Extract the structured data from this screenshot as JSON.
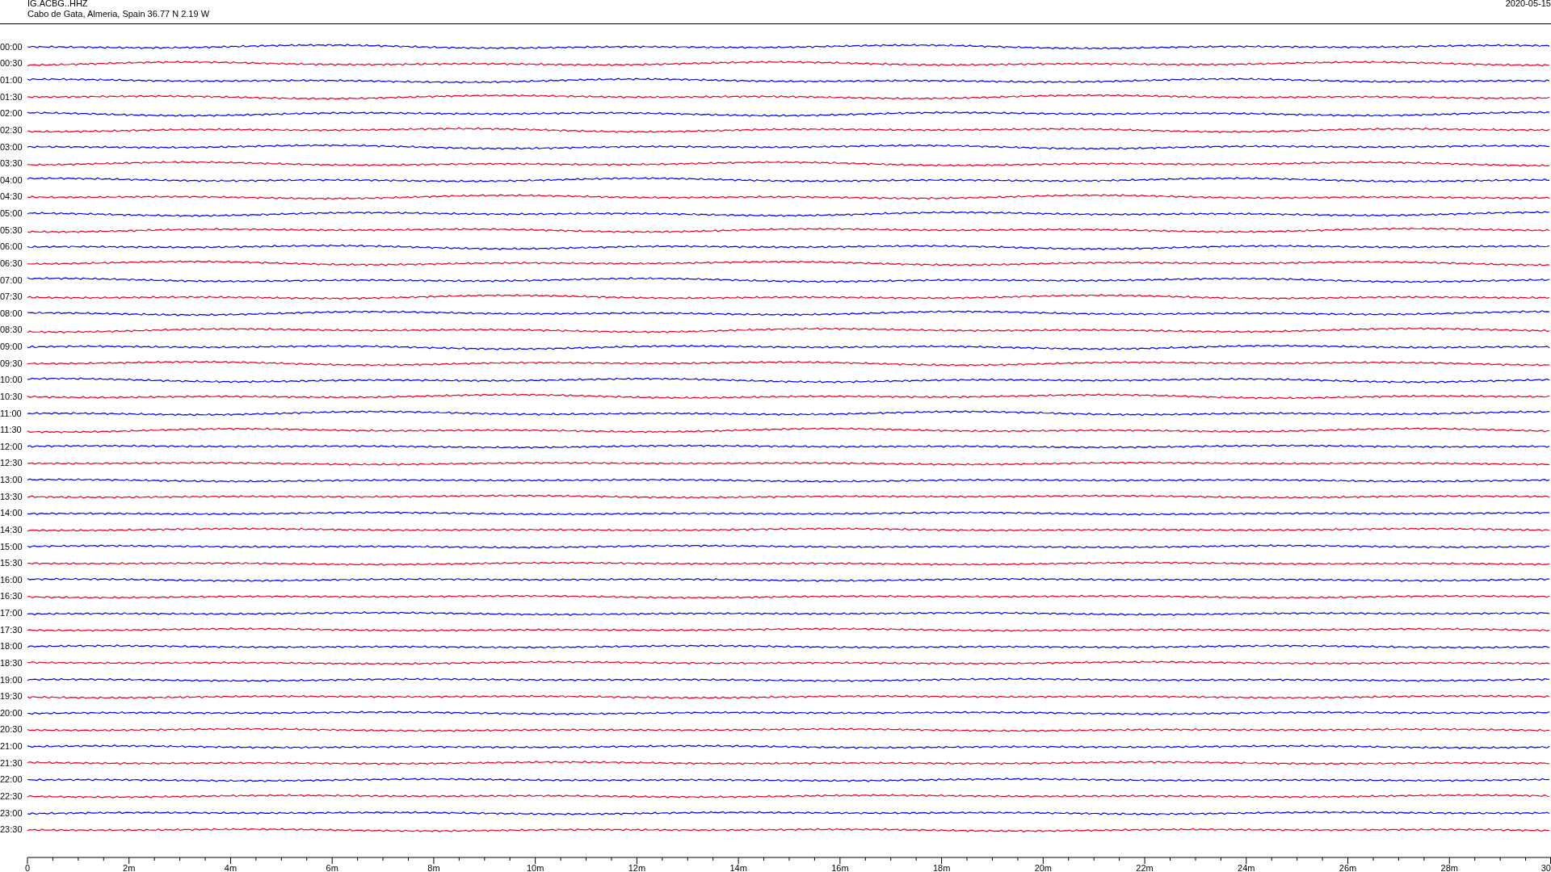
{
  "header": {
    "station": "IG.ACBG..HHZ",
    "location": "Cabo de Gata, Almeria, Spain  36.77 N 2.19 W",
    "date": "2020-05-15"
  },
  "traces": [
    {
      "time": "00:00",
      "color": "#0000ff"
    },
    {
      "time": "00:30",
      "color": "#ee0022"
    },
    {
      "time": "01:00",
      "color": "#0000ff"
    },
    {
      "time": "01:30",
      "color": "#ee0022"
    },
    {
      "time": "02:00",
      "color": "#0000ff"
    },
    {
      "time": "02:30",
      "color": "#ee0022"
    },
    {
      "time": "03:00",
      "color": "#0000ff"
    },
    {
      "time": "03:30",
      "color": "#ee0022"
    },
    {
      "time": "04:00",
      "color": "#0000ff"
    },
    {
      "time": "04:30",
      "color": "#ee0022"
    },
    {
      "time": "05:00",
      "color": "#0000ff"
    },
    {
      "time": "05:30",
      "color": "#ee0022"
    },
    {
      "time": "06:00",
      "color": "#0000ff"
    },
    {
      "time": "06:30",
      "color": "#ee0022"
    },
    {
      "time": "07:00",
      "color": "#0000ff"
    },
    {
      "time": "07:30",
      "color": "#ee0022"
    },
    {
      "time": "08:00",
      "color": "#0000ff"
    },
    {
      "time": "08:30",
      "color": "#ee0022"
    },
    {
      "time": "09:00",
      "color": "#0000ff"
    },
    {
      "time": "09:30",
      "color": "#ee0022"
    },
    {
      "time": "10:00",
      "color": "#0000ff"
    },
    {
      "time": "10:30",
      "color": "#ee0022"
    },
    {
      "time": "11:00",
      "color": "#0000ff"
    },
    {
      "time": "11:30",
      "color": "#ee0022"
    },
    {
      "time": "12:00",
      "color": "#0000ff"
    },
    {
      "time": "12:30",
      "color": "#ee0022"
    },
    {
      "time": "13:00",
      "color": "#0000ff"
    },
    {
      "time": "13:30",
      "color": "#ee0022"
    },
    {
      "time": "14:00",
      "color": "#0000ff"
    },
    {
      "time": "14:30",
      "color": "#ee0022"
    },
    {
      "time": "15:00",
      "color": "#0000ff"
    },
    {
      "time": "15:30",
      "color": "#ee0022"
    },
    {
      "time": "16:00",
      "color": "#0000ff"
    },
    {
      "time": "16:30",
      "color": "#ee0022"
    },
    {
      "time": "17:00",
      "color": "#0000ff"
    },
    {
      "time": "17:30",
      "color": "#ee0022"
    },
    {
      "time": "18:00",
      "color": "#0000ff"
    },
    {
      "time": "18:30",
      "color": "#ee0022"
    },
    {
      "time": "19:00",
      "color": "#0000ff"
    },
    {
      "time": "19:30",
      "color": "#ee0022"
    },
    {
      "time": "20:00",
      "color": "#0000ff"
    },
    {
      "time": "20:30",
      "color": "#ee0022"
    },
    {
      "time": "21:00",
      "color": "#0000ff"
    },
    {
      "time": "21:30",
      "color": "#ee0022"
    },
    {
      "time": "22:00",
      "color": "#0000ff"
    },
    {
      "time": "22:30",
      "color": "#ee0022"
    },
    {
      "time": "23:00",
      "color": "#0000ff"
    },
    {
      "time": "23:30",
      "color": "#ee0022"
    }
  ],
  "time_axis": {
    "labels": [
      "0",
      "2m",
      "4m",
      "6m",
      "8m",
      "10m",
      "12m",
      "14m",
      "16m",
      "18m",
      "20m",
      "22m",
      "24m",
      "26m",
      "28m",
      "30"
    ]
  }
}
